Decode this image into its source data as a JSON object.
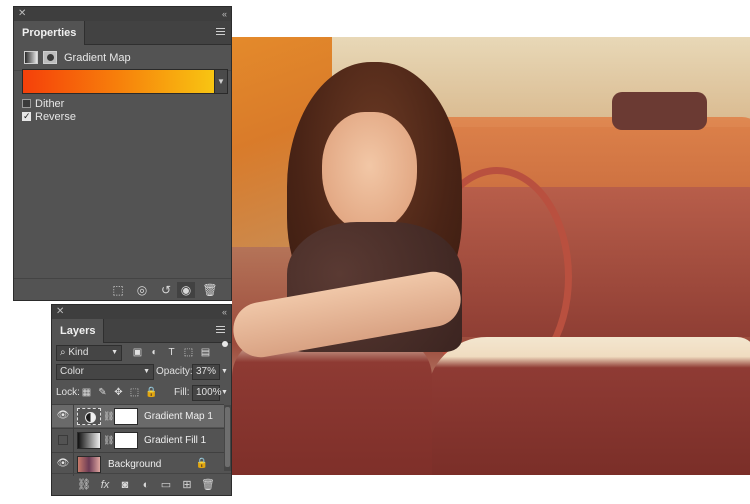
{
  "properties": {
    "tab_label": "Properties",
    "adjustment_title": "Gradient Map",
    "gradient": {
      "colors": [
        "#f5400a",
        "#f7800b",
        "#f8c512"
      ]
    },
    "dither": {
      "label": "Dither",
      "checked": false
    },
    "reverse": {
      "label": "Reverse",
      "checked": true
    },
    "footer_buttons": [
      "clip-to-layer-icon",
      "view-previous-state-icon",
      "reset-icon",
      "visibility-icon",
      "trash-icon"
    ]
  },
  "layers": {
    "tab_label": "Layers",
    "filter": {
      "kind": "Kind"
    },
    "blend_mode": "Color",
    "opacity_label": "Opacity:",
    "opacity_value": "37%",
    "lock_label": "Lock:",
    "fill_label": "Fill:",
    "fill_value": "100%",
    "items": [
      {
        "name": "Gradient Map 1",
        "visible": true,
        "selected": true
      },
      {
        "name": "Gradient Fill 1",
        "visible": false,
        "selected": false
      },
      {
        "name": "Background",
        "visible": true,
        "selected": false,
        "locked": true
      }
    ],
    "footer_buttons": [
      "link-layers-icon",
      "fx-icon",
      "add-mask-icon",
      "adjustment-layer-icon",
      "group-folder-icon",
      "new-layer-icon",
      "trash-icon"
    ]
  }
}
